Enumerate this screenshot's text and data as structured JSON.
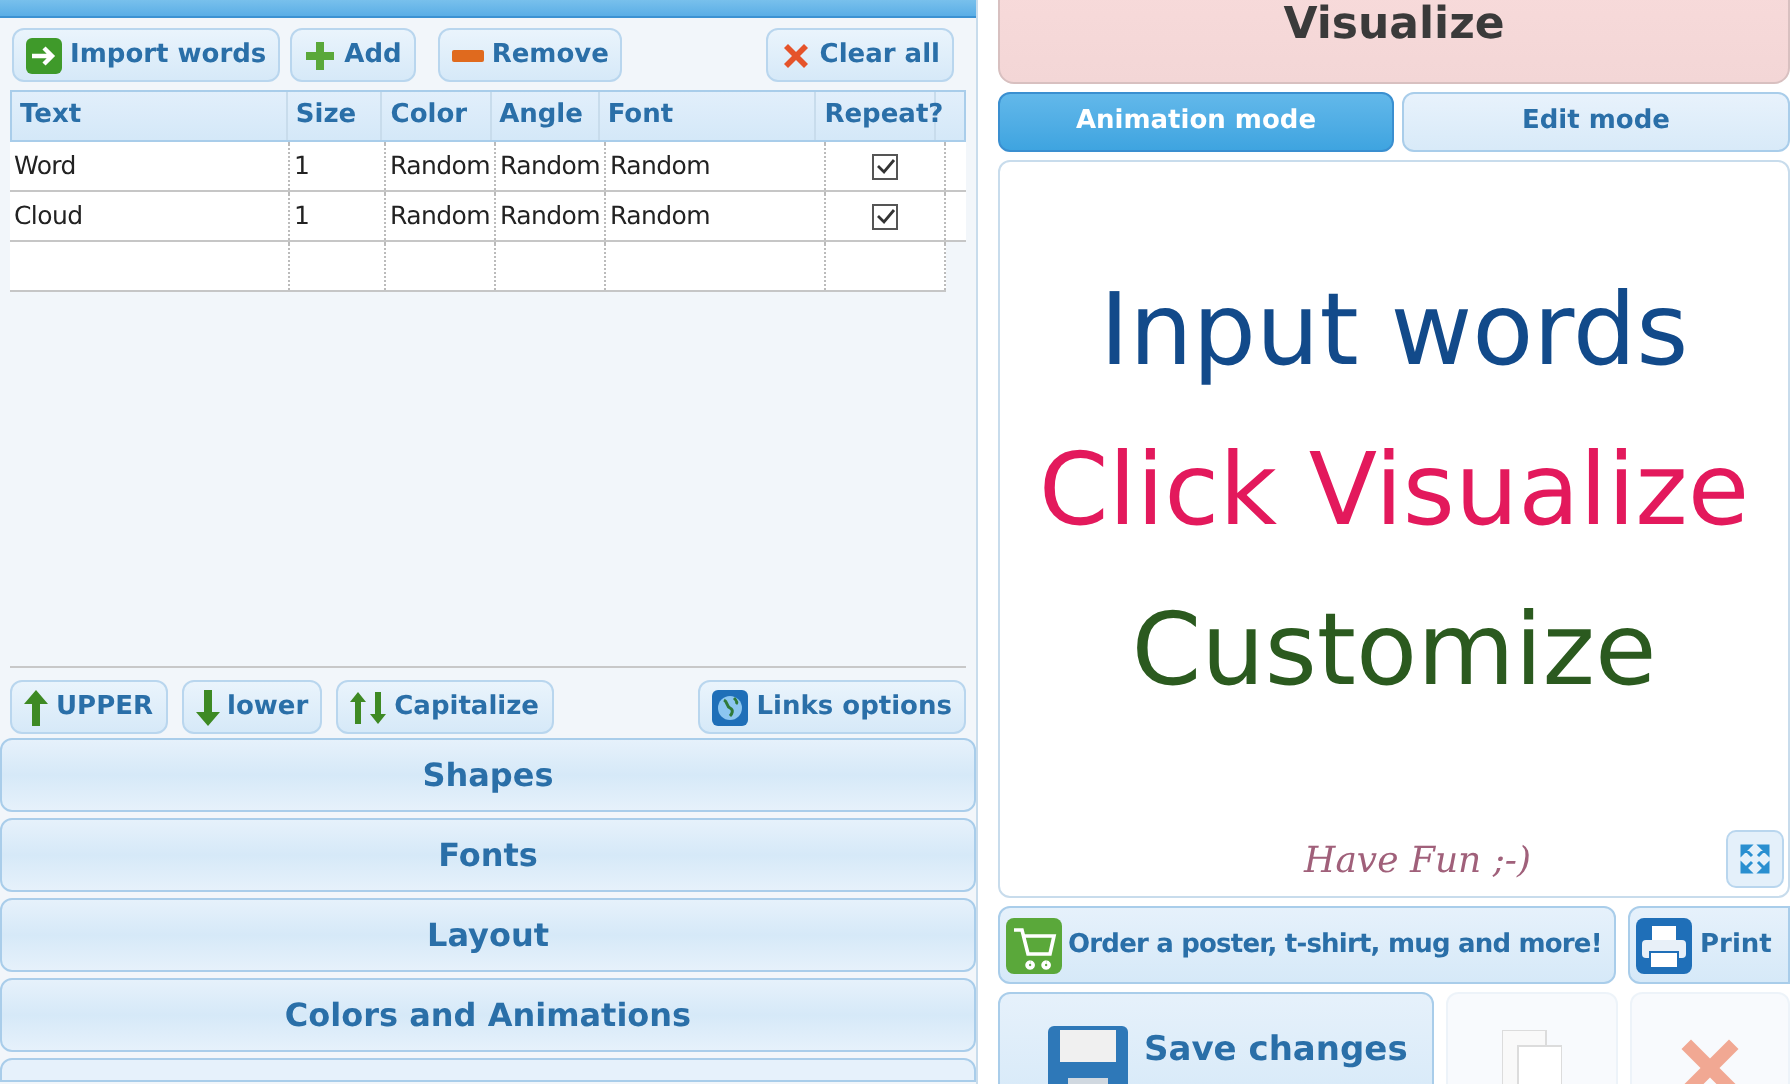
{
  "word_toolbar": [
    {
      "label": "Import words",
      "kind": "import"
    },
    {
      "label": "Add",
      "kind": "add"
    },
    {
      "label": "Remove",
      "kind": "remove"
    },
    {
      "label": "Clear all",
      "kind": "clear"
    }
  ],
  "table": {
    "columns": [
      "Text",
      "Size",
      "Color",
      "Angle",
      "Font",
      "Repeat?"
    ],
    "rows": [
      {
        "cells": [
          "Word",
          "1",
          "Random",
          "Random",
          "Random"
        ],
        "checked": true
      },
      {
        "cells": [
          "Cloud",
          "1",
          "Random",
          "Random",
          "Random"
        ],
        "checked": true
      }
    ]
  },
  "case_toolbar": [
    {
      "label": "UPPER",
      "kind": "upper"
    },
    {
      "label": "lower",
      "kind": "lower"
    },
    {
      "label": "Capitalize",
      "kind": "capitalize"
    },
    {
      "label": "Links options",
      "kind": "links"
    }
  ],
  "sections": [
    "Shapes",
    "Fonts",
    "Layout",
    "Colors and Animations"
  ],
  "visualize_button": "Visualize",
  "mode_tabs": [
    {
      "label": "Animation mode",
      "selected": true
    },
    {
      "label": "Edit mode",
      "selected": false
    }
  ],
  "canvas_words": [
    {
      "text": "Input words",
      "color": "#124a8a"
    },
    {
      "text": "Click Visualize",
      "color": "#e3195c"
    },
    {
      "text": "Customize",
      "color": "#2b5a1f"
    }
  ],
  "canvas_note": "Have Fun ;-)",
  "order_button": "Order a poster, t-shirt, mug and more!",
  "print_button": "Print",
  "save_button": "Save changes",
  "icon_buttons": [
    {
      "kind": "copy",
      "disabled": true
    },
    {
      "kind": "delete",
      "disabled": true
    }
  ]
}
